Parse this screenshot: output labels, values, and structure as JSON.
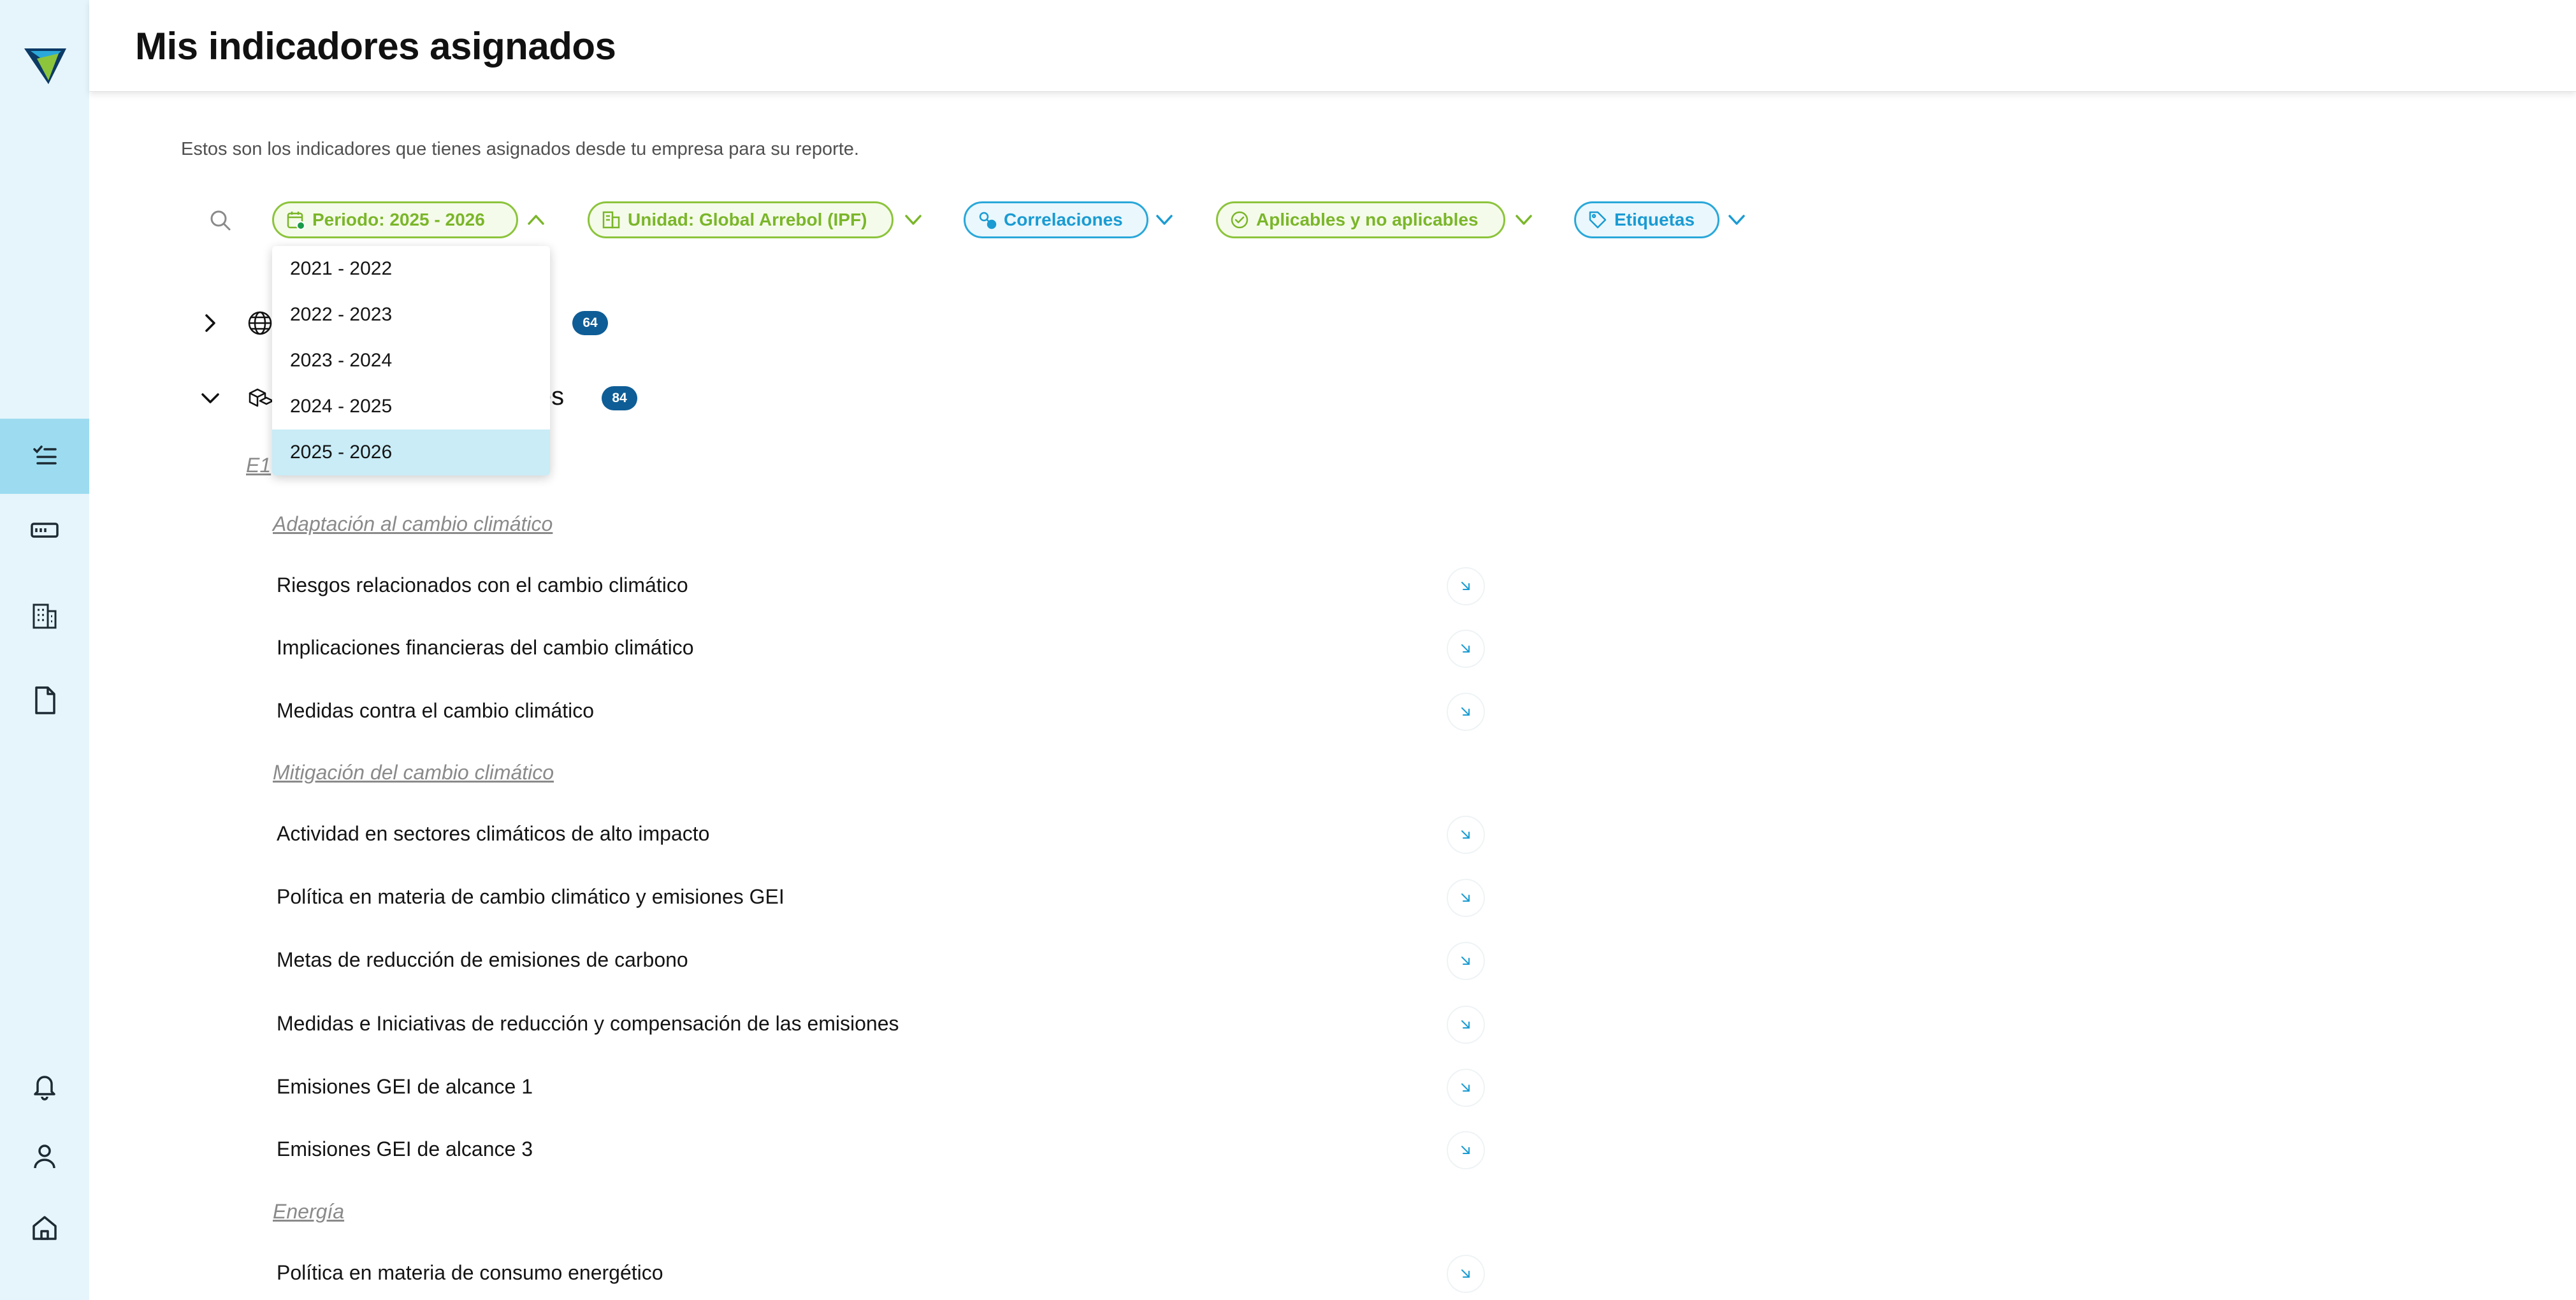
{
  "header": {
    "title": "Mis indicadores asignados"
  },
  "subtitle": "Estos son los indicadores que tienes asignados desde tu empresa para su reporte.",
  "filters": [
    {
      "label": "Periodo: 2025 - 2026",
      "icon": "calendar-icon",
      "color": "#7ab62a"
    },
    {
      "label": "Unidad: Global Arrebol (IPF)",
      "icon": "building-icon",
      "color": "#7ab62a"
    },
    {
      "label": "Correlaciones",
      "icon": "correlation-icon",
      "color": "#1a9bd2"
    },
    {
      "label": "Aplicables y no aplicables",
      "icon": "check-circle-icon",
      "color": "#7ab62a"
    },
    {
      "label": "Etiquetas",
      "icon": "tag-icon",
      "color": "#1a9bd2"
    }
  ],
  "period_dropdown": {
    "options": [
      "2021 - 2022",
      "2022 - 2023",
      "2023 - 2024",
      "2024 - 2025",
      "2025 - 2026"
    ],
    "selected": "2025 - 2026"
  },
  "groups": [
    {
      "label_visible": "s",
      "count": "64",
      "expanded": false,
      "icon": "globe-icon"
    },
    {
      "label_visible": "les",
      "count": "84",
      "expanded": true,
      "icon": "cubes-icon"
    }
  ],
  "section_code": "E1",
  "subsections": [
    {
      "title": "Adaptación al cambio climático",
      "items": [
        "Riesgos relacionados con el cambio climático",
        "Implicaciones financieras del cambio climático",
        "Medidas contra el cambio climático"
      ]
    },
    {
      "title": "Mitigación del cambio climático",
      "items": [
        "Actividad en sectores climáticos de alto impacto",
        "Política en materia de cambio climático y emisiones GEI",
        "Metas de reducción de emisiones de carbono",
        "Medidas e Iniciativas de reducción y compensación de las emisiones",
        "Emisiones GEI de alcance 1",
        "Emisiones GEI de alcance 3"
      ]
    },
    {
      "title": "Energía",
      "items": [
        "Política en materia de consumo energético"
      ]
    }
  ],
  "sidebar": {
    "items": [
      {
        "icon": "task-list-icon",
        "active": true
      },
      {
        "icon": "card-icon",
        "active": false
      },
      {
        "icon": "building-grid-icon",
        "active": false
      },
      {
        "icon": "document-icon",
        "active": false
      },
      {
        "icon": "bell-icon",
        "active": false
      },
      {
        "icon": "user-icon",
        "active": false
      },
      {
        "icon": "home-icon",
        "active": false
      }
    ]
  },
  "colors": {
    "sidebar_bg": "#e6f5fb",
    "sidebar_active": "#9ddcf0",
    "green": "#7ab62a",
    "blue": "#1a9bd2",
    "badge": "#0e5d96",
    "dropdown_selected": "#c9ecf7"
  }
}
